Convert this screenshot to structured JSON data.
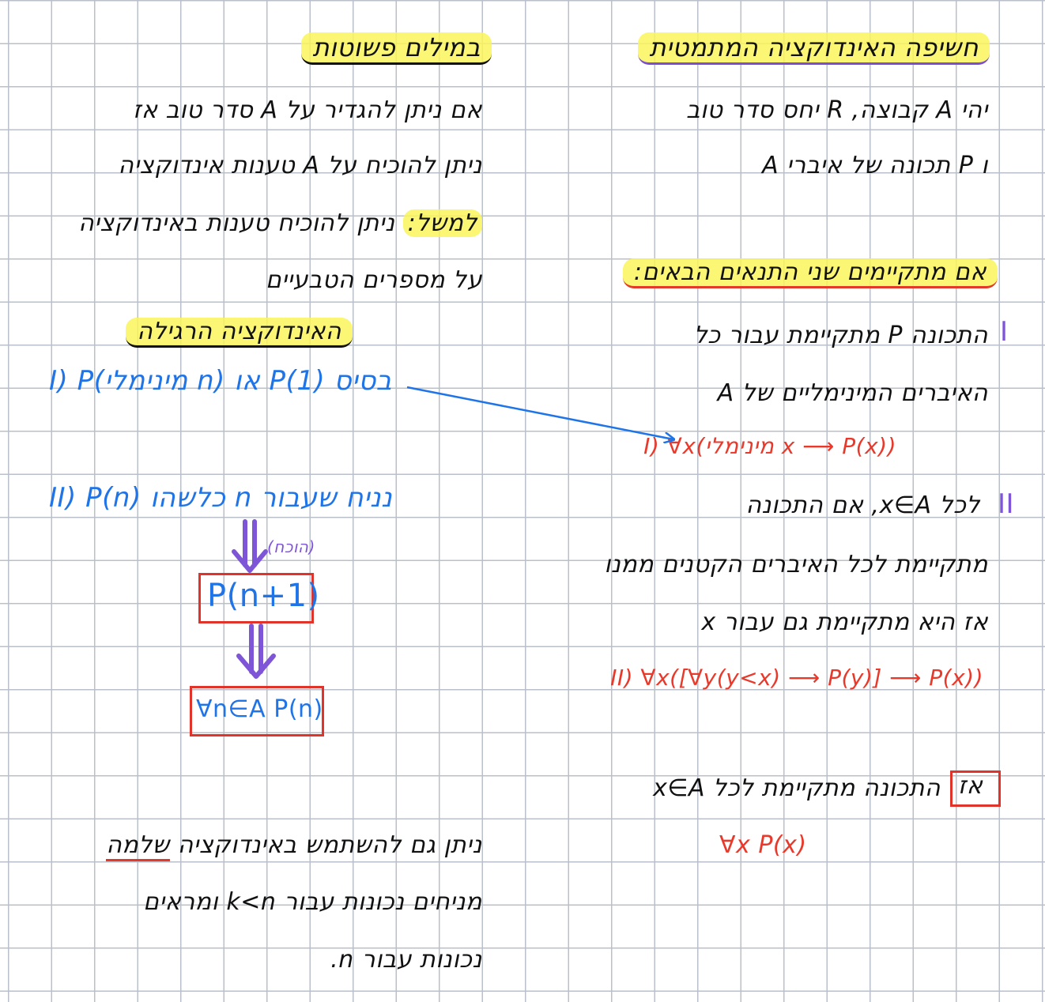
{
  "right": {
    "title": "חשיפה האינדוקציה המתמטית",
    "line1": "יהי A קבוצה, R יחס סדר טוב",
    "line2": "ו P תכונה של איברי A",
    "cond_header": "אם מתקיימים שני התנאים הבאים:",
    "c1_num": "I",
    "c1_line1": "התכונה P מתקיימת עבור כל",
    "c1_line2": "האיברים המינימליים של A",
    "c1_formula": "I) ∀x(מינימלי x ⟶ P(x))",
    "c2_num": "II",
    "c2_line1": "לכל x∈A, אם התכונה",
    "c2_line2": "מתקיימת לכל האיברים הקטנים ממנו",
    "c2_line3": "אז היא מתקיימת גם עבור x",
    "c2_formula": "II) ∀x([∀y(y<x) ⟶ P(y)] ⟶ P(x))",
    "then_label": "אז",
    "then_line": "התכונה מתקיימת לכל x∈A",
    "then_formula": "∀x P(x)"
  },
  "left": {
    "title": "במילים פשוטות",
    "line1": "אם ניתן להגדיר על A סדר טוב אז",
    "line2": "ניתן להוכיח על A טענות אינדוקציה",
    "line3_label": "למשל:",
    "line3_rest": "ניתן להוכיח טענות באינדוקציה",
    "line4": "על מספרים הטבעיים",
    "sub_title": "האינדוקציה הרגילה",
    "base": "I) P(מינימלי n) או P(1) בסיס",
    "step": "II) P(n) כלשהו n נניח שעבור",
    "step_label": "(הוכח)",
    "box1": "P(n+1)",
    "box2": "∀n∈A P(n)",
    "strong1_a": "ניתן גם להשתמש באינדוקציה",
    "strong1_b": "שלמה",
    "strong2": "מניחים נכונות עבור k<n ומראים",
    "strong3": "נכונות עבור n."
  },
  "colors": {
    "blue_ink": "#1f74e8",
    "red_ink": "#e8392b",
    "purple_ink": "#7f55d8",
    "highlight": "#faf55a"
  }
}
